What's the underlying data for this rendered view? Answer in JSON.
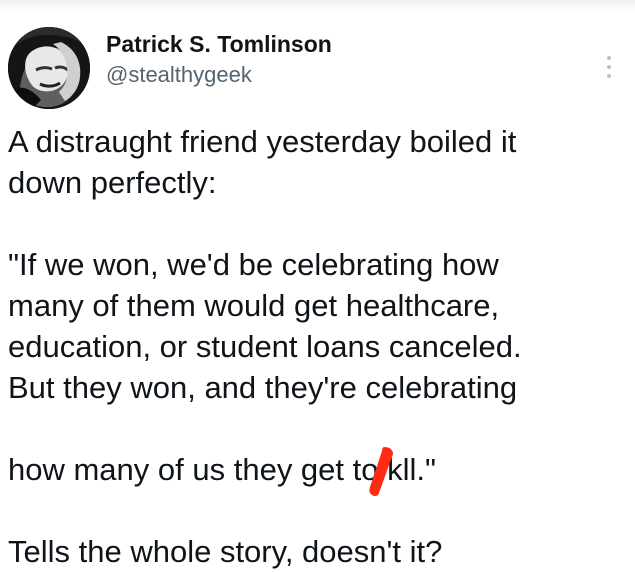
{
  "tweet": {
    "author": {
      "name": "Patrick S. Tomlinson",
      "handle": "@stealthygeek"
    },
    "menu_icon": "more-vertical-icon",
    "text": {
      "line1": "A distraught friend yesterday boiled it",
      "line2": "down perfectly:",
      "quote_line1": "\"If we won, we'd be celebrating how",
      "quote_line2": "many of them would get healthcare,",
      "quote_line3": "education, or student loans canceled.",
      "quote_line4": "But they won, and they're celebrating",
      "quote_line5_before": "how many of us they get to k",
      "quote_line5_after": "ll.\"",
      "closing": "Tells the whole story, doesn't it?"
    },
    "redaction_color": "#ff2b17"
  }
}
